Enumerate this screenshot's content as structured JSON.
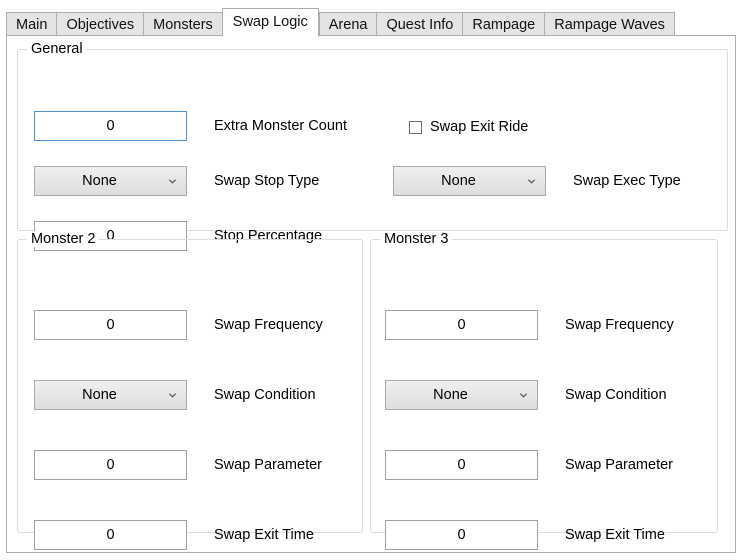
{
  "tabs": [
    {
      "label": "Main",
      "selected": false
    },
    {
      "label": "Objectives",
      "selected": false
    },
    {
      "label": "Monsters",
      "selected": false
    },
    {
      "label": "Swap Logic",
      "selected": true
    },
    {
      "label": "Arena",
      "selected": false
    },
    {
      "label": "Quest Info",
      "selected": false
    },
    {
      "label": "Rampage",
      "selected": false
    },
    {
      "label": "Rampage Waves",
      "selected": false
    }
  ],
  "general": {
    "title": "General",
    "extra_monster_count": {
      "label": "Extra Monster Count",
      "value": "0"
    },
    "swap_exit_ride": {
      "label": "Swap Exit Ride",
      "checked": false
    },
    "swap_stop_type": {
      "label": "Swap Stop Type",
      "value": "None"
    },
    "swap_exec_type": {
      "label": "Swap Exec Type",
      "value": "None"
    },
    "stop_percentage": {
      "label": "Stop Percentage",
      "value": "0"
    }
  },
  "monster2": {
    "title": "Monster 2",
    "swap_frequency": {
      "label": "Swap Frequency",
      "value": "0"
    },
    "swap_condition": {
      "label": "Swap Condition",
      "value": "None"
    },
    "swap_parameter": {
      "label": "Swap Parameter",
      "value": "0"
    },
    "swap_exit_time": {
      "label": "Swap Exit Time",
      "value": "0"
    }
  },
  "monster3": {
    "title": "Monster 3",
    "swap_frequency": {
      "label": "Swap Frequency",
      "value": "0"
    },
    "swap_condition": {
      "label": "Swap Condition",
      "value": "None"
    },
    "swap_parameter": {
      "label": "Swap Parameter",
      "value": "0"
    },
    "swap_exit_time": {
      "label": "Swap Exit Time",
      "value": "0"
    }
  },
  "icons": {
    "combo_chevron": "chevron-down-icon",
    "checkbox": "checkbox-unchecked-icon"
  },
  "colors": {
    "focus_border": "#4a90d9",
    "group_border": "#d6dde5",
    "panel_border": "#adadad",
    "combo_face": "#e6e6e6"
  }
}
